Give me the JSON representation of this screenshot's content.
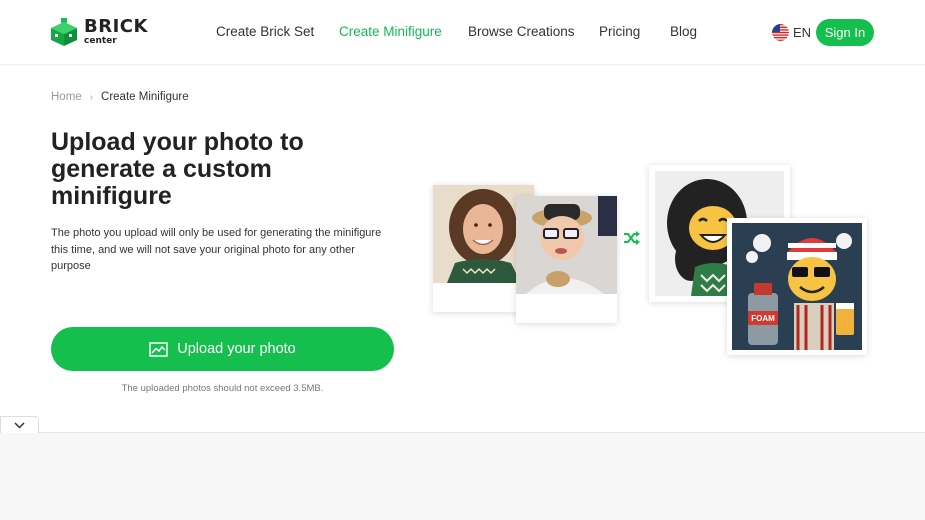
{
  "brand": {
    "name": "BRICK",
    "sub": "center"
  },
  "nav": {
    "items": [
      {
        "label": "Create Brick Set",
        "active": false
      },
      {
        "label": "Create Minifigure",
        "active": true
      },
      {
        "label": "Browse Creations",
        "active": false
      },
      {
        "label": "Pricing",
        "active": false
      },
      {
        "label": "Blog",
        "active": false
      }
    ],
    "language": "EN",
    "sign_in": "Sign In"
  },
  "breadcrumb": {
    "home": "Home",
    "current": "Create Minifigure"
  },
  "hero": {
    "title": "Upload your photo to generate a custom minifigure",
    "description": "The photo you upload will only be used for generating the minifigure this time, and we will not save your original photo for any other purpose",
    "upload_label": "Upload your photo",
    "upload_note": "The uploaded photos should not exceed 3.5MB."
  },
  "collage": {
    "foam_label": "FOAM"
  },
  "icons": {
    "logo": "brick-logo-icon",
    "flag": "us-flag-icon",
    "upload": "image-icon",
    "shuffle": "shuffle-icon",
    "collapse": "chevron-down-icon"
  },
  "colors": {
    "accent": "#14bf4e",
    "text": "#222222",
    "muted": "#9a9a9a"
  }
}
